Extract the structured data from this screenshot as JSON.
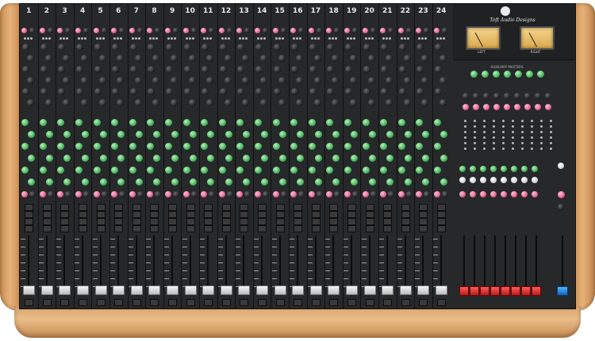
{
  "console": {
    "brand_text": "Toft Audio Designs",
    "colors": {
      "panel": "#26282a",
      "knob_pink": "#e25b85",
      "knob_green": "#3fae55",
      "wood": "#d9a46c",
      "vu_face": "#f0c878",
      "fader_red": "#d62b2b",
      "fader_blue": "#1f7fd6"
    },
    "channels": [
      "1",
      "2",
      "3",
      "4",
      "5",
      "6",
      "7",
      "8",
      "9",
      "10",
      "11",
      "12",
      "13",
      "14",
      "15",
      "16",
      "17",
      "18",
      "19",
      "20",
      "21",
      "22",
      "23",
      "24"
    ],
    "meters": {
      "left_label": "LEFT",
      "right_label": "RIGHT"
    },
    "aux_masters_label": "AUXILIARY MASTERS",
    "master_section": {
      "red_fader_count": 8,
      "blue_fader_count": 1
    }
  }
}
